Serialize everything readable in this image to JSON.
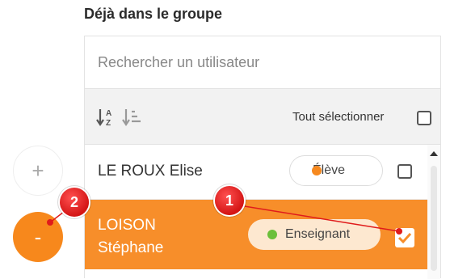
{
  "group": {
    "title": "Déjà dans le groupe",
    "search_placeholder": "Rechercher un utilisateur",
    "select_all_label": "Tout sélectionner",
    "sort_icons": [
      "sort-alpha-icon",
      "sort-list-icon"
    ]
  },
  "users": [
    {
      "name": "LE ROUX Elise",
      "role": "Élève",
      "role_color": "#f6891f",
      "checked": false,
      "selected": false
    },
    {
      "name_line1": "LOISON",
      "name_line2": "Stéphane",
      "role": "Enseignant",
      "role_color": "#6bbf3a",
      "checked": true,
      "selected": true
    }
  ],
  "actions": {
    "add_label": "+",
    "remove_label": "-"
  },
  "annotations": [
    {
      "label": "1"
    },
    {
      "label": "2"
    }
  ],
  "colors": {
    "accent": "#f78e2a",
    "annotation": "#e01b1b"
  }
}
